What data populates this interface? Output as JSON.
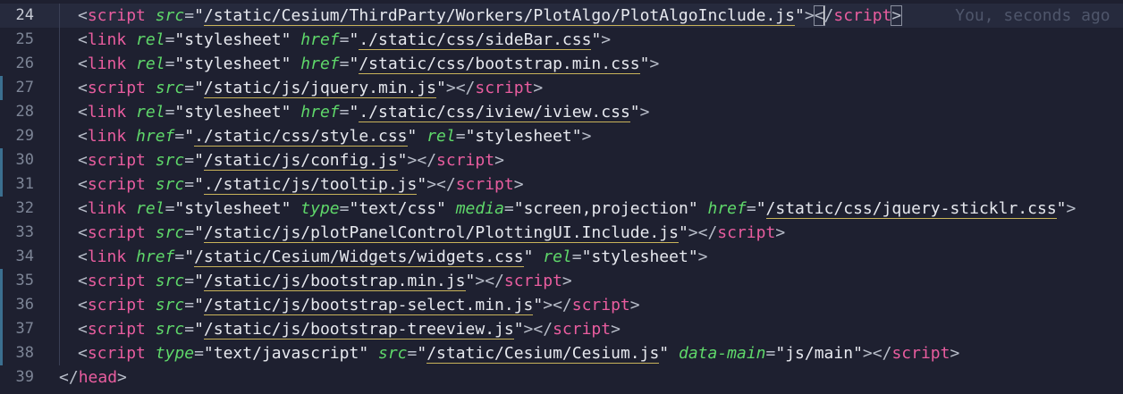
{
  "editor": {
    "blame": "You, seconds ago",
    "lines": [
      {
        "num": "24",
        "ind": 1,
        "active": true,
        "mod": false,
        "tokens": [
          {
            "t": "punct",
            "v": "<"
          },
          {
            "t": "tag",
            "v": "script"
          },
          {
            "t": "ws",
            "v": " "
          },
          {
            "t": "attr",
            "v": "src"
          },
          {
            "t": "eq",
            "v": "="
          },
          {
            "t": "str",
            "v": "\""
          },
          {
            "t": "path",
            "v": "/static/Cesium/ThirdParty/Workers/PlotAlgo/PlotAlgoInclude.js"
          },
          {
            "t": "str",
            "v": "\""
          },
          {
            "t": "punct",
            "v": ">"
          },
          {
            "t": "punct",
            "v": "<",
            "box": true
          },
          {
            "t": "cursor"
          },
          {
            "t": "punct",
            "v": "/"
          },
          {
            "t": "tag",
            "v": "script"
          },
          {
            "t": "punct",
            "v": ">",
            "box": true
          },
          {
            "t": "blame"
          }
        ]
      },
      {
        "num": "25",
        "ind": 1,
        "active": false,
        "mod": false,
        "tokens": [
          {
            "t": "punct",
            "v": "<"
          },
          {
            "t": "tag",
            "v": "link"
          },
          {
            "t": "ws",
            "v": " "
          },
          {
            "t": "attr",
            "v": "rel"
          },
          {
            "t": "eq",
            "v": "="
          },
          {
            "t": "str",
            "v": "\"stylesheet\""
          },
          {
            "t": "ws",
            "v": " "
          },
          {
            "t": "attr",
            "v": "href"
          },
          {
            "t": "eq",
            "v": "="
          },
          {
            "t": "str",
            "v": "\""
          },
          {
            "t": "path",
            "v": "./static/css/sideBar.css"
          },
          {
            "t": "str",
            "v": "\""
          },
          {
            "t": "punct",
            "v": ">"
          }
        ]
      },
      {
        "num": "26",
        "ind": 1,
        "active": false,
        "mod": false,
        "tokens": [
          {
            "t": "punct",
            "v": "<"
          },
          {
            "t": "tag",
            "v": "link"
          },
          {
            "t": "ws",
            "v": " "
          },
          {
            "t": "attr",
            "v": "rel"
          },
          {
            "t": "eq",
            "v": "="
          },
          {
            "t": "str",
            "v": "\"stylesheet\""
          },
          {
            "t": "ws",
            "v": " "
          },
          {
            "t": "attr",
            "v": "href"
          },
          {
            "t": "eq",
            "v": "="
          },
          {
            "t": "str",
            "v": "\""
          },
          {
            "t": "path",
            "v": "/static/css/bootstrap.min.css"
          },
          {
            "t": "str",
            "v": "\""
          },
          {
            "t": "punct",
            "v": ">"
          }
        ]
      },
      {
        "num": "27",
        "ind": 1,
        "active": false,
        "mod": true,
        "tokens": [
          {
            "t": "punct",
            "v": "<"
          },
          {
            "t": "tag",
            "v": "script"
          },
          {
            "t": "ws",
            "v": " "
          },
          {
            "t": "attr",
            "v": "src"
          },
          {
            "t": "eq",
            "v": "="
          },
          {
            "t": "str",
            "v": "\""
          },
          {
            "t": "path",
            "v": "/static/js/jquery.min.js"
          },
          {
            "t": "str",
            "v": "\""
          },
          {
            "t": "punct",
            "v": "></"
          },
          {
            "t": "tag",
            "v": "script"
          },
          {
            "t": "punct",
            "v": ">"
          }
        ]
      },
      {
        "num": "28",
        "ind": 1,
        "active": false,
        "mod": false,
        "tokens": [
          {
            "t": "punct",
            "v": "<"
          },
          {
            "t": "tag",
            "v": "link"
          },
          {
            "t": "ws",
            "v": " "
          },
          {
            "t": "attr",
            "v": "rel"
          },
          {
            "t": "eq",
            "v": "="
          },
          {
            "t": "str",
            "v": "\"stylesheet\""
          },
          {
            "t": "ws",
            "v": " "
          },
          {
            "t": "attr",
            "v": "href"
          },
          {
            "t": "eq",
            "v": "="
          },
          {
            "t": "str",
            "v": "\""
          },
          {
            "t": "path",
            "v": "./static/css/iview/iview.css"
          },
          {
            "t": "str",
            "v": "\""
          },
          {
            "t": "punct",
            "v": ">"
          }
        ]
      },
      {
        "num": "29",
        "ind": 1,
        "active": false,
        "mod": false,
        "tokens": [
          {
            "t": "punct",
            "v": "<"
          },
          {
            "t": "tag",
            "v": "link"
          },
          {
            "t": "ws",
            "v": " "
          },
          {
            "t": "attr",
            "v": "href"
          },
          {
            "t": "eq",
            "v": "="
          },
          {
            "t": "str",
            "v": "\""
          },
          {
            "t": "path",
            "v": "./static/css/style.css"
          },
          {
            "t": "str",
            "v": "\""
          },
          {
            "t": "ws",
            "v": " "
          },
          {
            "t": "attr",
            "v": "rel"
          },
          {
            "t": "eq",
            "v": "="
          },
          {
            "t": "str",
            "v": "\"stylesheet\""
          },
          {
            "t": "punct",
            "v": ">"
          }
        ]
      },
      {
        "num": "30",
        "ind": 1,
        "active": false,
        "mod": true,
        "tokens": [
          {
            "t": "punct",
            "v": "<"
          },
          {
            "t": "tag",
            "v": "script"
          },
          {
            "t": "ws",
            "v": " "
          },
          {
            "t": "attr",
            "v": "src"
          },
          {
            "t": "eq",
            "v": "="
          },
          {
            "t": "str",
            "v": "\""
          },
          {
            "t": "path",
            "v": "/static/js/config.js"
          },
          {
            "t": "str",
            "v": "\""
          },
          {
            "t": "punct",
            "v": "></"
          },
          {
            "t": "tag",
            "v": "script"
          },
          {
            "t": "punct",
            "v": ">"
          }
        ]
      },
      {
        "num": "31",
        "ind": 1,
        "active": false,
        "mod": true,
        "tokens": [
          {
            "t": "punct",
            "v": "<"
          },
          {
            "t": "tag",
            "v": "script"
          },
          {
            "t": "ws",
            "v": " "
          },
          {
            "t": "attr",
            "v": "src"
          },
          {
            "t": "eq",
            "v": "="
          },
          {
            "t": "str",
            "v": "\""
          },
          {
            "t": "path",
            "v": "./static/js/tooltip.js"
          },
          {
            "t": "str",
            "v": "\""
          },
          {
            "t": "punct",
            "v": "></"
          },
          {
            "t": "tag",
            "v": "script"
          },
          {
            "t": "punct",
            "v": ">"
          }
        ]
      },
      {
        "num": "32",
        "ind": 1,
        "active": false,
        "mod": false,
        "tokens": [
          {
            "t": "punct",
            "v": "<"
          },
          {
            "t": "tag",
            "v": "link"
          },
          {
            "t": "ws",
            "v": " "
          },
          {
            "t": "attr",
            "v": "rel"
          },
          {
            "t": "eq",
            "v": "="
          },
          {
            "t": "str",
            "v": "\"stylesheet\""
          },
          {
            "t": "ws",
            "v": " "
          },
          {
            "t": "attr",
            "v": "type"
          },
          {
            "t": "eq",
            "v": "="
          },
          {
            "t": "str",
            "v": "\"text/css\""
          },
          {
            "t": "ws",
            "v": " "
          },
          {
            "t": "attr",
            "v": "media"
          },
          {
            "t": "eq",
            "v": "="
          },
          {
            "t": "str",
            "v": "\"screen,projection\""
          },
          {
            "t": "ws",
            "v": " "
          },
          {
            "t": "attr",
            "v": "href"
          },
          {
            "t": "eq",
            "v": "="
          },
          {
            "t": "str",
            "v": "\""
          },
          {
            "t": "path",
            "v": "/static/css/jquery-sticklr.css"
          },
          {
            "t": "str",
            "v": "\""
          },
          {
            "t": "punct",
            "v": ">"
          }
        ]
      },
      {
        "num": "33",
        "ind": 1,
        "active": false,
        "mod": false,
        "tokens": [
          {
            "t": "punct",
            "v": "<"
          },
          {
            "t": "tag",
            "v": "script"
          },
          {
            "t": "ws",
            "v": " "
          },
          {
            "t": "attr",
            "v": "src"
          },
          {
            "t": "eq",
            "v": "="
          },
          {
            "t": "str",
            "v": "\""
          },
          {
            "t": "path",
            "v": "/static/js/plotPanelControl/PlottingUI.Include.js"
          },
          {
            "t": "str",
            "v": "\""
          },
          {
            "t": "punct",
            "v": "></"
          },
          {
            "t": "tag",
            "v": "script"
          },
          {
            "t": "punct",
            "v": ">"
          }
        ]
      },
      {
        "num": "34",
        "ind": 1,
        "active": false,
        "mod": false,
        "tokens": [
          {
            "t": "punct",
            "v": "<"
          },
          {
            "t": "tag",
            "v": "link"
          },
          {
            "t": "ws",
            "v": " "
          },
          {
            "t": "attr",
            "v": "href"
          },
          {
            "t": "eq",
            "v": "="
          },
          {
            "t": "str",
            "v": "\""
          },
          {
            "t": "path",
            "v": "/static/Cesium/Widgets/widgets.css"
          },
          {
            "t": "str",
            "v": "\""
          },
          {
            "t": "ws",
            "v": " "
          },
          {
            "t": "attr",
            "v": "rel"
          },
          {
            "t": "eq",
            "v": "="
          },
          {
            "t": "str",
            "v": "\"stylesheet\""
          },
          {
            "t": "punct",
            "v": ">"
          }
        ]
      },
      {
        "num": "35",
        "ind": 1,
        "active": false,
        "mod": true,
        "tokens": [
          {
            "t": "punct",
            "v": "<"
          },
          {
            "t": "tag",
            "v": "script"
          },
          {
            "t": "ws",
            "v": " "
          },
          {
            "t": "attr",
            "v": "src"
          },
          {
            "t": "eq",
            "v": "="
          },
          {
            "t": "str",
            "v": "\""
          },
          {
            "t": "path",
            "v": "/static/js/bootstrap.min.js"
          },
          {
            "t": "str",
            "v": "\""
          },
          {
            "t": "punct",
            "v": "></"
          },
          {
            "t": "tag",
            "v": "script"
          },
          {
            "t": "punct",
            "v": ">"
          }
        ]
      },
      {
        "num": "36",
        "ind": 1,
        "active": false,
        "mod": true,
        "tokens": [
          {
            "t": "punct",
            "v": "<"
          },
          {
            "t": "tag",
            "v": "script"
          },
          {
            "t": "ws",
            "v": " "
          },
          {
            "t": "attr",
            "v": "src"
          },
          {
            "t": "eq",
            "v": "="
          },
          {
            "t": "str",
            "v": "\""
          },
          {
            "t": "path",
            "v": "/static/js/bootstrap-select.min.js"
          },
          {
            "t": "str",
            "v": "\""
          },
          {
            "t": "punct",
            "v": "></"
          },
          {
            "t": "tag",
            "v": "script"
          },
          {
            "t": "punct",
            "v": ">"
          }
        ]
      },
      {
        "num": "37",
        "ind": 1,
        "active": false,
        "mod": true,
        "tokens": [
          {
            "t": "punct",
            "v": "<"
          },
          {
            "t": "tag",
            "v": "script"
          },
          {
            "t": "ws",
            "v": " "
          },
          {
            "t": "attr",
            "v": "src"
          },
          {
            "t": "eq",
            "v": "="
          },
          {
            "t": "str",
            "v": "\""
          },
          {
            "t": "path",
            "v": "/static/js/bootstrap-treeview.js"
          },
          {
            "t": "str",
            "v": "\""
          },
          {
            "t": "punct",
            "v": "></"
          },
          {
            "t": "tag",
            "v": "script"
          },
          {
            "t": "punct",
            "v": ">"
          }
        ]
      },
      {
        "num": "38",
        "ind": 1,
        "active": false,
        "mod": true,
        "tokens": [
          {
            "t": "punct",
            "v": "<"
          },
          {
            "t": "tag",
            "v": "script"
          },
          {
            "t": "ws",
            "v": " "
          },
          {
            "t": "attr",
            "v": "type"
          },
          {
            "t": "eq",
            "v": "="
          },
          {
            "t": "str",
            "v": "\"text/javascript\""
          },
          {
            "t": "ws",
            "v": " "
          },
          {
            "t": "attr",
            "v": "src"
          },
          {
            "t": "eq",
            "v": "="
          },
          {
            "t": "str",
            "v": "\""
          },
          {
            "t": "path",
            "v": "/static/Cesium/Cesium.js"
          },
          {
            "t": "str",
            "v": "\""
          },
          {
            "t": "ws",
            "v": " "
          },
          {
            "t": "attr",
            "v": "data-main"
          },
          {
            "t": "eq",
            "v": "="
          },
          {
            "t": "str",
            "v": "\"js/main\""
          },
          {
            "t": "punct",
            "v": "></"
          },
          {
            "t": "tag",
            "v": "script"
          },
          {
            "t": "punct",
            "v": ">"
          }
        ]
      },
      {
        "num": "39",
        "ind": 0,
        "active": false,
        "mod": false,
        "tokens": [
          {
            "t": "punct",
            "v": "</"
          },
          {
            "t": "tag",
            "v": "head"
          },
          {
            "t": "punct",
            "v": ">"
          }
        ]
      }
    ]
  }
}
